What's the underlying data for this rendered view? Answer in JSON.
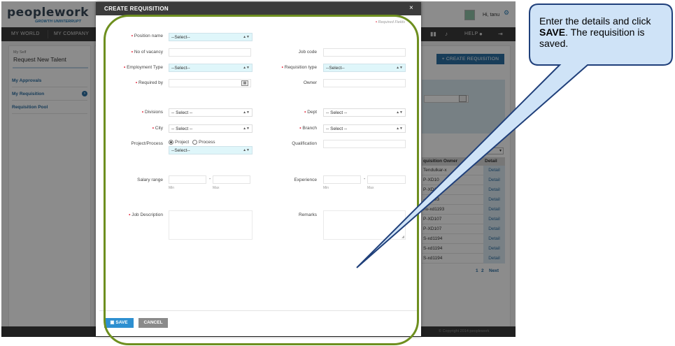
{
  "app": {
    "logo_text": "peoplework",
    "logo_tagline": "GROWTH UNINTERRUPT",
    "greeting": "Hi, tanu",
    "nav": {
      "my_world": "MY WORLD",
      "my_company": "MY COMPANY",
      "help": "HELP"
    },
    "sidebar": {
      "my_self": "My Self",
      "title": "Request New Talent",
      "items": [
        "My Approvals",
        "My Requisition",
        "Requisition Pool"
      ]
    },
    "create_requisition_label": "+ CREATE REQUISITION",
    "table": {
      "headers": [
        "quisition Owner",
        "Detail"
      ],
      "rows": [
        {
          "owner": "Tendulkar-x",
          "detail": "Detail"
        },
        {
          "owner": "P-XD10",
          "detail": "Detail"
        },
        {
          "owner": "P-XD10",
          "detail": "Detail"
        },
        {
          "owner": "-xd1193",
          "detail": "Detail"
        },
        {
          "owner": "nu-xd1193",
          "detail": "Detail"
        },
        {
          "owner": "P-XD107",
          "detail": "Detail"
        },
        {
          "owner": "P-XD107",
          "detail": "Detail"
        },
        {
          "owner": "S-xd1194",
          "detail": "Detail"
        },
        {
          "owner": "S-xd1194",
          "detail": "Detail"
        },
        {
          "owner": "S-xd1194",
          "detail": "Detail"
        }
      ],
      "pager": [
        "1",
        "2",
        "Next"
      ]
    },
    "copyright": "© Copyright 2014 peoplework"
  },
  "modal": {
    "title": "CREATE REQUISITION",
    "close": "×",
    "required_note": "Required Fields",
    "fields": {
      "position_name": {
        "label": "Position name",
        "value": "--Select--"
      },
      "no_of_vacancy": {
        "label": "No of vacancy"
      },
      "job_code": {
        "label": "Job code"
      },
      "employment_type": {
        "label": "Employment Type",
        "value": "--Select--"
      },
      "requisition_type": {
        "label": "Requisition type",
        "value": "--Select--"
      },
      "required_by": {
        "label": "Required by"
      },
      "owner": {
        "label": "Owner"
      },
      "divisions": {
        "label": "Divisions",
        "value": "-- Select --"
      },
      "dept": {
        "label": "Dept",
        "value": "-- Select --"
      },
      "city": {
        "label": "City",
        "value": "-- Select --"
      },
      "branch": {
        "label": "Branch",
        "value": "-- Select --"
      },
      "project_process": {
        "label": "Project/Process",
        "option_project": "Project",
        "option_process": "Process",
        "value": "--Select--"
      },
      "qualification": {
        "label": "Qualification"
      },
      "salary_range": {
        "label": "Salary range",
        "min": "Min",
        "max": "Max"
      },
      "experience": {
        "label": "Experience",
        "min": "Min",
        "max": "Max"
      },
      "job_description": {
        "label": "Job Description"
      },
      "remarks": {
        "label": "Remarks"
      }
    },
    "buttons": {
      "save": "SAVE",
      "cancel": "CANCEL"
    }
  },
  "callout": {
    "text_before": "Enter the details and click ",
    "text_bold": "SAVE",
    "text_after": ". The requisition is saved."
  },
  "colors": {
    "highlight_ring": "#6e8f1f",
    "callout_fill": "#cfe3f7",
    "callout_border": "#1f3f7a",
    "accent": "#2d6fa3"
  }
}
